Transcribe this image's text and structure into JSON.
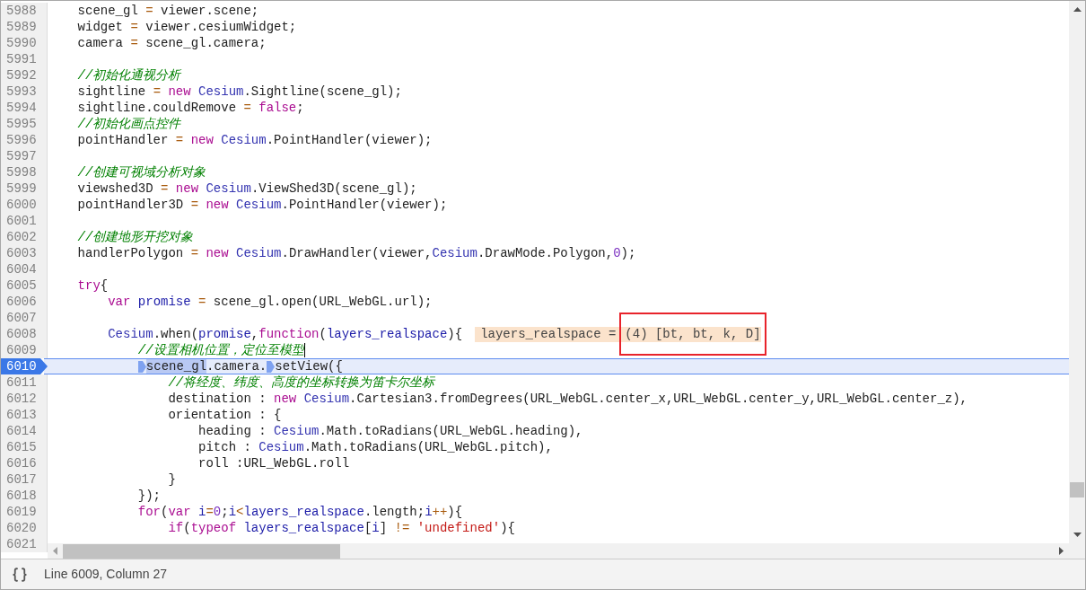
{
  "editor": {
    "lines": [
      {
        "number": "5988",
        "paused": false,
        "caret": false,
        "tokens": [
          {
            "kind": "plain",
            "text": "    scene_gl "
          },
          {
            "kind": "operator",
            "text": "="
          },
          {
            "kind": "plain",
            "text": " viewer.scene;"
          }
        ]
      },
      {
        "number": "5989",
        "paused": false,
        "caret": false,
        "tokens": [
          {
            "kind": "plain",
            "text": "    widget "
          },
          {
            "kind": "operator",
            "text": "="
          },
          {
            "kind": "plain",
            "text": " viewer.cesiumWidget;"
          }
        ]
      },
      {
        "number": "5990",
        "paused": false,
        "caret": false,
        "tokens": [
          {
            "kind": "plain",
            "text": "    camera "
          },
          {
            "kind": "operator",
            "text": "="
          },
          {
            "kind": "plain",
            "text": " scene_gl.camera;"
          }
        ]
      },
      {
        "number": "5991",
        "paused": false,
        "caret": false
      },
      {
        "number": "5992",
        "paused": false,
        "caret": false,
        "tokens": [
          {
            "kind": "comment",
            "text": "    //初始化通视分析"
          }
        ]
      },
      {
        "number": "5993",
        "paused": false,
        "caret": false,
        "tokens": [
          {
            "kind": "plain",
            "text": "    sightline "
          },
          {
            "kind": "operator",
            "text": "="
          },
          {
            "kind": "keyword",
            "text": " new "
          },
          {
            "kind": "type",
            "text": "Cesium"
          },
          {
            "kind": "plain",
            "text": ".Sightline(scene_gl);"
          }
        ]
      },
      {
        "number": "5994",
        "paused": false,
        "caret": false,
        "tokens": [
          {
            "kind": "plain",
            "text": "    sightline.couldRemove "
          },
          {
            "kind": "operator",
            "text": "="
          },
          {
            "kind": "keyword",
            "text": " false"
          },
          {
            "kind": "plain",
            "text": ";"
          }
        ]
      },
      {
        "number": "5995",
        "paused": false,
        "caret": false,
        "tokens": [
          {
            "kind": "comment",
            "text": "    //初始化画点控件"
          }
        ]
      },
      {
        "number": "5996",
        "paused": false,
        "caret": false,
        "tokens": [
          {
            "kind": "plain",
            "text": "    pointHandler "
          },
          {
            "kind": "operator",
            "text": "="
          },
          {
            "kind": "keyword",
            "text": " new "
          },
          {
            "kind": "type",
            "text": "Cesium"
          },
          {
            "kind": "plain",
            "text": ".PointHandler(viewer);"
          }
        ]
      },
      {
        "number": "5997",
        "paused": false,
        "caret": false
      },
      {
        "number": "5998",
        "paused": false,
        "caret": false,
        "tokens": [
          {
            "kind": "comment",
            "text": "    //创建可视域分析对象"
          }
        ]
      },
      {
        "number": "5999",
        "paused": false,
        "caret": false,
        "tokens": [
          {
            "kind": "plain",
            "text": "    viewshed3D "
          },
          {
            "kind": "operator",
            "text": "="
          },
          {
            "kind": "keyword",
            "text": " new "
          },
          {
            "kind": "type",
            "text": "Cesium"
          },
          {
            "kind": "plain",
            "text": ".ViewShed3D(scene_gl);"
          }
        ]
      },
      {
        "number": "6000",
        "paused": false,
        "caret": false,
        "tokens": [
          {
            "kind": "plain",
            "text": "    pointHandler3D "
          },
          {
            "kind": "operator",
            "text": "="
          },
          {
            "kind": "keyword",
            "text": " new "
          },
          {
            "kind": "type",
            "text": "Cesium"
          },
          {
            "kind": "plain",
            "text": ".PointHandler(viewer);"
          }
        ]
      },
      {
        "number": "6001",
        "paused": false,
        "caret": false
      },
      {
        "number": "6002",
        "paused": false,
        "caret": false,
        "tokens": [
          {
            "kind": "comment",
            "text": "    //创建地形开挖对象"
          }
        ]
      },
      {
        "number": "6003",
        "paused": false,
        "caret": false,
        "tokens": [
          {
            "kind": "plain",
            "text": "    handlerPolygon "
          },
          {
            "kind": "operator",
            "text": "="
          },
          {
            "kind": "keyword",
            "text": " new "
          },
          {
            "kind": "type",
            "text": "Cesium"
          },
          {
            "kind": "plain",
            "text": ".DrawHandler(viewer,"
          },
          {
            "kind": "type",
            "text": "Cesium"
          },
          {
            "kind": "plain",
            "text": ".DrawMode.Polygon,"
          },
          {
            "kind": "number",
            "text": "0"
          },
          {
            "kind": "plain",
            "text": ");"
          }
        ]
      },
      {
        "number": "6004",
        "paused": false,
        "caret": false
      },
      {
        "number": "6005",
        "paused": false,
        "caret": false,
        "tokens": [
          {
            "kind": "keyword",
            "text": "    try"
          },
          {
            "kind": "plain",
            "text": "{"
          }
        ]
      },
      {
        "number": "6006",
        "paused": false,
        "caret": false,
        "tokens": [
          {
            "kind": "keyword",
            "text": "        var "
          },
          {
            "kind": "definition",
            "text": "promise "
          },
          {
            "kind": "operator",
            "text": "="
          },
          {
            "kind": "plain",
            "text": " scene_gl.open(URL_WebGL.url);"
          }
        ]
      },
      {
        "number": "6007",
        "paused": false,
        "caret": false
      },
      {
        "number": "6008",
        "paused": false,
        "caret": false,
        "tokens": [
          {
            "kind": "type",
            "text": "        Cesium"
          },
          {
            "kind": "plain",
            "text": ".when("
          },
          {
            "kind": "definition",
            "text": "promise"
          },
          {
            "kind": "plain",
            "text": ","
          },
          {
            "kind": "keyword",
            "text": "function"
          },
          {
            "kind": "plain",
            "text": "("
          },
          {
            "kind": "definition",
            "text": "layers_realspace"
          },
          {
            "kind": "plain",
            "text": "){"
          }
        ],
        "inline_value": {
          "name": "layers_realspace =",
          "value": "(4) [bt, bt, k, D]",
          "outlined": true
        }
      },
      {
        "number": "6009",
        "paused": false,
        "caret": true,
        "tokens": [
          {
            "kind": "comment",
            "text": "            //设置相机位置，定位至模型"
          }
        ]
      },
      {
        "number": "6010",
        "paused": true,
        "caret": false,
        "tokens": [
          {
            "kind": "step",
            "selected": true,
            "text": "            scene_gl"
          },
          {
            "kind": "plain",
            "text": ".camera."
          },
          {
            "kind": "step",
            "selected": false,
            "text": "setView({"
          }
        ]
      },
      {
        "number": "6011",
        "paused": false,
        "caret": false,
        "tokens": [
          {
            "kind": "comment",
            "text": "                //将经度、纬度、高度的坐标转换为笛卡尔坐标"
          }
        ]
      },
      {
        "number": "6012",
        "paused": false,
        "caret": false,
        "tokens": [
          {
            "kind": "plain",
            "text": "                destination : "
          },
          {
            "kind": "keyword",
            "text": "new "
          },
          {
            "kind": "type",
            "text": "Cesium"
          },
          {
            "kind": "plain",
            "text": ".Cartesian3.fromDegrees(URL_WebGL.center_x,URL_WebGL.center_y,URL_WebGL.center_z),"
          }
        ]
      },
      {
        "number": "6013",
        "paused": false,
        "caret": false,
        "tokens": [
          {
            "kind": "plain",
            "text": "                orientation : {"
          }
        ]
      },
      {
        "number": "6014",
        "paused": false,
        "caret": false,
        "tokens": [
          {
            "kind": "plain",
            "text": "                    heading : "
          },
          {
            "kind": "type",
            "text": "Cesium"
          },
          {
            "kind": "plain",
            "text": ".Math.toRadians(URL_WebGL.heading),"
          }
        ]
      },
      {
        "number": "6015",
        "paused": false,
        "caret": false,
        "tokens": [
          {
            "kind": "plain",
            "text": "                    pitch : "
          },
          {
            "kind": "type",
            "text": "Cesium"
          },
          {
            "kind": "plain",
            "text": ".Math.toRadians(URL_WebGL.pitch),"
          }
        ]
      },
      {
        "number": "6016",
        "paused": false,
        "caret": false,
        "tokens": [
          {
            "kind": "plain",
            "text": "                    roll :URL_WebGL.roll"
          }
        ]
      },
      {
        "number": "6017",
        "paused": false,
        "caret": false,
        "tokens": [
          {
            "kind": "plain",
            "text": "                }"
          }
        ]
      },
      {
        "number": "6018",
        "paused": false,
        "caret": false,
        "tokens": [
          {
            "kind": "plain",
            "text": "            });"
          }
        ]
      },
      {
        "number": "6019",
        "paused": false,
        "caret": false,
        "tokens": [
          {
            "kind": "keyword",
            "text": "            for"
          },
          {
            "kind": "plain",
            "text": "("
          },
          {
            "kind": "keyword",
            "text": "var "
          },
          {
            "kind": "definition",
            "text": "i"
          },
          {
            "kind": "operator",
            "text": "="
          },
          {
            "kind": "number",
            "text": "0"
          },
          {
            "kind": "plain",
            "text": ";"
          },
          {
            "kind": "definition",
            "text": "i"
          },
          {
            "kind": "operator",
            "text": "<"
          },
          {
            "kind": "definition",
            "text": "layers_realspace"
          },
          {
            "kind": "plain",
            "text": ".length;"
          },
          {
            "kind": "definition",
            "text": "i"
          },
          {
            "kind": "operator",
            "text": "++"
          },
          {
            "kind": "plain",
            "text": "){"
          }
        ]
      },
      {
        "number": "6020",
        "paused": false,
        "caret": false,
        "tokens": [
          {
            "kind": "keyword",
            "text": "                if"
          },
          {
            "kind": "plain",
            "text": "("
          },
          {
            "kind": "keyword",
            "text": "typeof "
          },
          {
            "kind": "definition",
            "text": "layers_realspace"
          },
          {
            "kind": "plain",
            "text": "["
          },
          {
            "kind": "definition",
            "text": "i"
          },
          {
            "kind": "plain",
            "text": "] "
          },
          {
            "kind": "operator",
            "text": "!="
          },
          {
            "kind": "string",
            "text": " 'undefined'"
          },
          {
            "kind": "plain",
            "text": "){"
          }
        ]
      },
      {
        "number": "6021",
        "paused": false,
        "caret": false
      }
    ]
  },
  "status_bar": {
    "position": "Line 6009, Column 27"
  }
}
